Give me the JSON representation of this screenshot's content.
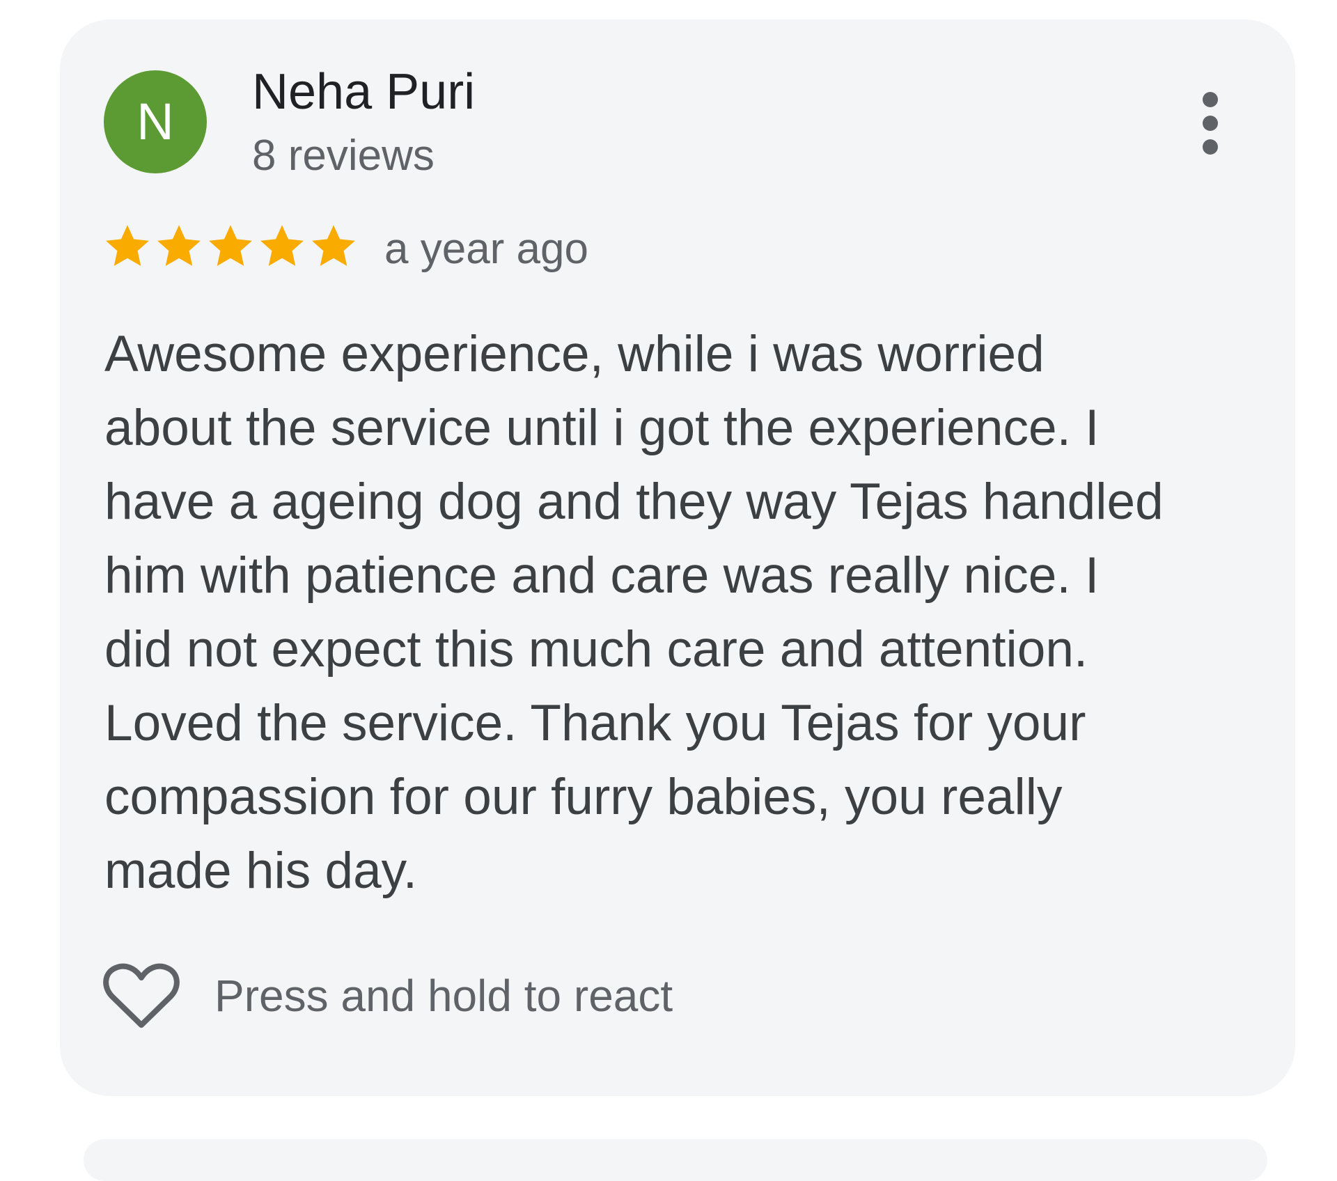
{
  "review": {
    "avatar_initial": "N",
    "reviewer_name": "Neha Puri",
    "review_count": "8 reviews",
    "rating": 5,
    "rating_max": 5,
    "date": "a year ago",
    "text_lines": [
      "Awesome experience, while i was worried",
      "about the service until i got the experience. I",
      "have a ageing dog and they way Tejas handled",
      "him with patience and care was really nice. I",
      "did not expect this much care and attention.",
      "Loved the service. Thank you Tejas for your",
      "compassion for our furry babies, you really",
      "made his day."
    ],
    "react_label": "Press and hold to react"
  },
  "icons": {
    "more": "more-vert-icon",
    "star": "star-icon",
    "heart": "heart-outline-icon"
  },
  "colors": {
    "card_background": "#f4f5f7",
    "avatar_background": "#5c9b33",
    "star": "#f9ab00",
    "primary_text": "#202124",
    "secondary_text": "#5f6368",
    "body_text": "#3c4043"
  }
}
